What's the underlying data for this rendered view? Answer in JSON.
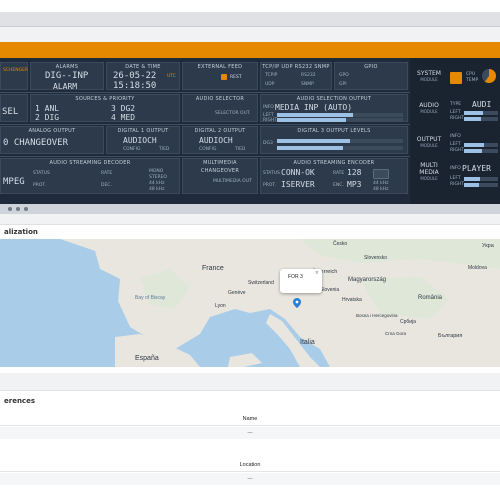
{
  "device": {
    "cells": {
      "alarms": {
        "title": "ALARMS",
        "line1": "DIG--INP",
        "line2": "ALARM"
      },
      "date_time": {
        "title": "DATE & TIME",
        "date": "26-05-22",
        "time": "15:18:50",
        "utc": "UTC"
      },
      "external_feed": {
        "title": "EXTERNAL FEED",
        "rest": "REST"
      },
      "tcp_ip": {
        "title": "TCP/IP UDP RS232 SNMP",
        "tcpip": "TCPIP",
        "rs232": "RS232",
        "udp": "UDP",
        "snmp": "SNMP"
      },
      "gpio": {
        "title": "GPIO",
        "gpo": "GPO",
        "gpi": "GPI"
      },
      "sources_priority": {
        "title": "SOURCES & PRIORITY",
        "s1": "1 ANL",
        "s2": "2 DIG",
        "s3": "3 DG2",
        "s4": "4 MED"
      },
      "audio_selector": {
        "title": "AUDIO SELECTOR",
        "sub": "SELECTOR OUT."
      },
      "audio_selection_output": {
        "title": "AUDIO SELECTION OUTPUT",
        "value": "MEDIA INP (AUTO)",
        "info": "INFO",
        "left": "LEFT",
        "right": "RIGHT"
      },
      "analog_output": {
        "title": "ANALOG OUTPUT",
        "value": "CHANGEOVER"
      },
      "digital1": {
        "title": "DIGITAL 1 OUTPUT",
        "value": "AUDIOCH",
        "config": "CONFIG",
        "tied": "TIED"
      },
      "digital2": {
        "title": "DIGITAL 2 OUTPUT",
        "value": "AUDIOCH",
        "config": "CONFIG",
        "tied": "TIED"
      },
      "digital3_levels": {
        "title": "DIGITAL 3 OUTPUT LEVELS",
        "dg3": "DG3"
      },
      "streaming_decoder": {
        "title": "AUDIO STREAMING DECODER",
        "value": "MPEG",
        "status": "STATUS",
        "prot": "PROT.",
        "rate": "RATE",
        "dec": "DEC.",
        "mono": "MONO",
        "stereo": "STEREO",
        "khz44": "44 kHz",
        "khz48": "48 kHz"
      },
      "multimedia_changeover": {
        "title": "MULTIMEDIA CHANGEOVER",
        "sub": "MULTIMEDIA OUT"
      },
      "streaming_encoder": {
        "title": "AUDIO STREAMING ENCODER",
        "status": "STATUS",
        "prot": "PROT.",
        "state": "CONN-OK",
        "server": "ISERVER",
        "rate": "RATE",
        "enc": "ENC.",
        "bitrate": "128",
        "format": "MP3",
        "khz44": "44 kHz",
        "khz48": "48 kHz"
      },
      "left_fragment": {
        "sel": "SEL",
        "changeover_label": "0 CHANGEOVER"
      }
    },
    "right": {
      "system": {
        "label": "SYSTEM",
        "sub": "MODULE",
        "cpu": "CPU",
        "temp": "TEMP"
      },
      "audio": {
        "label": "AUDIO",
        "sub": "MODULE",
        "type": "TYPE",
        "value": "AUDI",
        "left": "LEFT",
        "right": "RIGHT"
      },
      "output": {
        "label": "OUTPUT",
        "sub": "MODULE",
        "info": "INFO",
        "left": "LEFT",
        "right": "RIGHT"
      },
      "multimedia": {
        "label": "MULTI MEDIA",
        "sub": "MODULE",
        "info": "INFO",
        "value": "PLAYER",
        "left": "LEFT",
        "right": "RIGHT"
      }
    }
  },
  "localization": {
    "title": "alization",
    "map": {
      "popup": "FOR 3",
      "labels": {
        "france": "France",
        "espana": "España",
        "italia": "Italia",
        "switzerland": "Switzerland",
        "ceska": "Česko",
        "slovensko": "Slovensko",
        "osterreich": "Österreich",
        "slovenia": "Slovenia",
        "hrvatska": "Hrvatska",
        "magyarorszag": "Magyarország",
        "romania": "România",
        "bosna": "Bosna i Hercegovina",
        "srbija": "Србија",
        "bulgaria": "България",
        "crna_gora": "Crna Gora",
        "ukraine": "Укра",
        "moldova": "Moldova",
        "bay_of_biscay": "Bay of Biscay",
        "geneve": "Genève",
        "lyon": "Lyon"
      }
    }
  },
  "references": {
    "title": "erences",
    "columns": {
      "name": "Name",
      "location": "Location"
    },
    "rows": {
      "name_value": "—",
      "location_value": "—"
    }
  },
  "colors": {
    "accent": "#e58a00",
    "device_bg": "#1f2b3a",
    "map_water": "#a9cde8",
    "land": "#e9e6df",
    "pin": "#2a7fd4"
  }
}
